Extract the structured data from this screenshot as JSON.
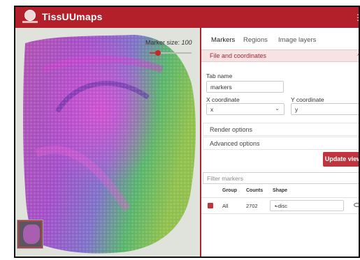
{
  "app": {
    "title": "TissUUmaps"
  },
  "viewer": {
    "marker_size_label": "Marker size:",
    "marker_size_value": "100",
    "marker_slider_fraction": 0.2
  },
  "panel": {
    "tabs": [
      "Markers",
      "Regions",
      "Image layers"
    ],
    "active_tab": "Markers",
    "section_header": "File and coordinates",
    "tab_name_label": "Tab name",
    "tab_name_value": "markers",
    "x_label": "X coordinate",
    "x_value": "x",
    "y_label": "Y coordinate",
    "y_value": "y",
    "render_options": "Render options",
    "advanced_options": "Advanced options",
    "update_button": "Update view",
    "filter_placeholder": "Filter markers"
  },
  "table": {
    "headers": [
      "Group",
      "Counts",
      "Shape"
    ],
    "rows": [
      {
        "group": "All",
        "counts": "2702",
        "shape": "• disc"
      }
    ]
  },
  "colors": {
    "brand": "#b3202a",
    "accent_light": "#f7e3e4",
    "button": "#c0343d"
  }
}
